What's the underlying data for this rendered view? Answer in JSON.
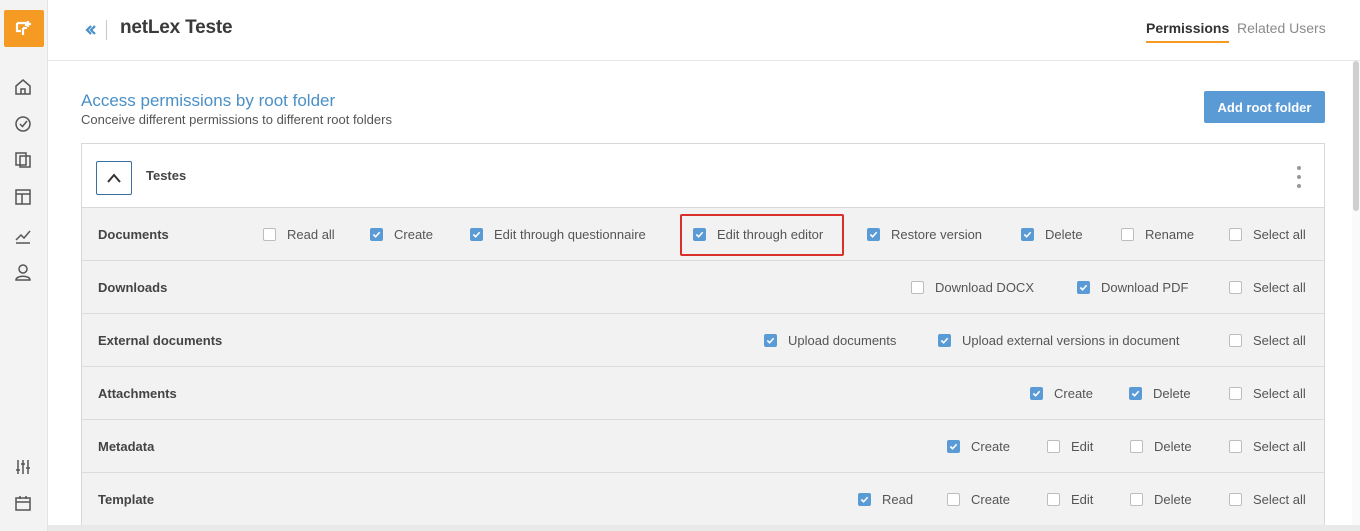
{
  "header": {
    "title": "netLex Teste",
    "tabs": [
      {
        "label": "Permissions",
        "active": true
      },
      {
        "label": "Related Users",
        "active": false
      }
    ]
  },
  "sidebar": {
    "items": [
      {
        "icon": "home-icon"
      },
      {
        "icon": "dashboard-check-icon"
      },
      {
        "icon": "documents-icon"
      },
      {
        "icon": "templates-icon"
      },
      {
        "icon": "analytics-icon"
      },
      {
        "icon": "user-icon"
      },
      {
        "icon": "settings-sliders-icon"
      },
      {
        "icon": "calendar-icon"
      }
    ]
  },
  "main": {
    "title": "Access permissions by root folder",
    "subtitle": "Conceive different permissions to different root folders",
    "add_button": "Add root folder",
    "folder": {
      "name": "Testes",
      "rows": [
        {
          "label": "Documents",
          "options": [
            {
              "label": "Read all",
              "checked": false
            },
            {
              "label": "Create",
              "checked": true
            },
            {
              "label": "Edit through questionnaire",
              "checked": true
            },
            {
              "label": "Edit through editor",
              "checked": true,
              "highlighted": true
            },
            {
              "label": "Restore version",
              "checked": true
            },
            {
              "label": "Delete",
              "checked": true
            },
            {
              "label": "Rename",
              "checked": false
            },
            {
              "label": "Select all",
              "checked": false
            }
          ]
        },
        {
          "label": "Downloads",
          "options": [
            {
              "label": "Download DOCX",
              "checked": false
            },
            {
              "label": "Download PDF",
              "checked": true
            },
            {
              "label": "Select all",
              "checked": false
            }
          ]
        },
        {
          "label": "External documents",
          "options": [
            {
              "label": "Upload documents",
              "checked": true
            },
            {
              "label": "Upload external versions in document",
              "checked": true
            },
            {
              "label": "Select all",
              "checked": false
            }
          ]
        },
        {
          "label": "Attachments",
          "options": [
            {
              "label": "Create",
              "checked": true
            },
            {
              "label": "Delete",
              "checked": true
            },
            {
              "label": "Select all",
              "checked": false
            }
          ]
        },
        {
          "label": "Metadata",
          "options": [
            {
              "label": "Create",
              "checked": true
            },
            {
              "label": "Edit",
              "checked": false
            },
            {
              "label": "Delete",
              "checked": false
            },
            {
              "label": "Select all",
              "checked": false
            }
          ]
        },
        {
          "label": "Template",
          "options": [
            {
              "label": "Read",
              "checked": true
            },
            {
              "label": "Create",
              "checked": false
            },
            {
              "label": "Edit",
              "checked": false
            },
            {
              "label": "Delete",
              "checked": false
            },
            {
              "label": "Select all",
              "checked": false
            }
          ]
        }
      ]
    }
  },
  "colors": {
    "accent": "#f59a23",
    "primary": "#5b9bd5",
    "title": "#4a90c8",
    "highlight": "#d9302c"
  }
}
